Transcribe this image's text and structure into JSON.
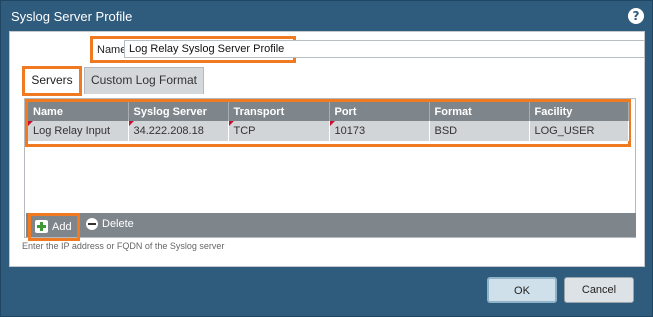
{
  "dialog": {
    "title": "Syslog Server Profile",
    "help_icon": "question-circle-icon"
  },
  "name_field": {
    "label": "Name",
    "value": "Log Relay Syslog Server Profile"
  },
  "tabs": [
    {
      "label": "Servers",
      "active": true
    },
    {
      "label": "Custom Log Format",
      "active": false
    }
  ],
  "grid": {
    "columns": [
      "Name",
      "Syslog Server",
      "Transport",
      "Port",
      "Format",
      "Facility"
    ],
    "rows": [
      {
        "name": "Log Relay Input",
        "syslog_server": "34.222.208.18",
        "transport": "TCP",
        "port": "10173",
        "format": "BSD",
        "facility": "LOG_USER"
      }
    ]
  },
  "toolbar": {
    "add_label": "Add",
    "delete_label": "Delete"
  },
  "hint": "Enter the IP address or FQDN of the Syslog server",
  "buttons": {
    "ok": "OK",
    "cancel": "Cancel"
  },
  "colors": {
    "highlight": "#f07a22",
    "header_bg": "#7e858b",
    "title_bg": "#2f5b7c"
  }
}
